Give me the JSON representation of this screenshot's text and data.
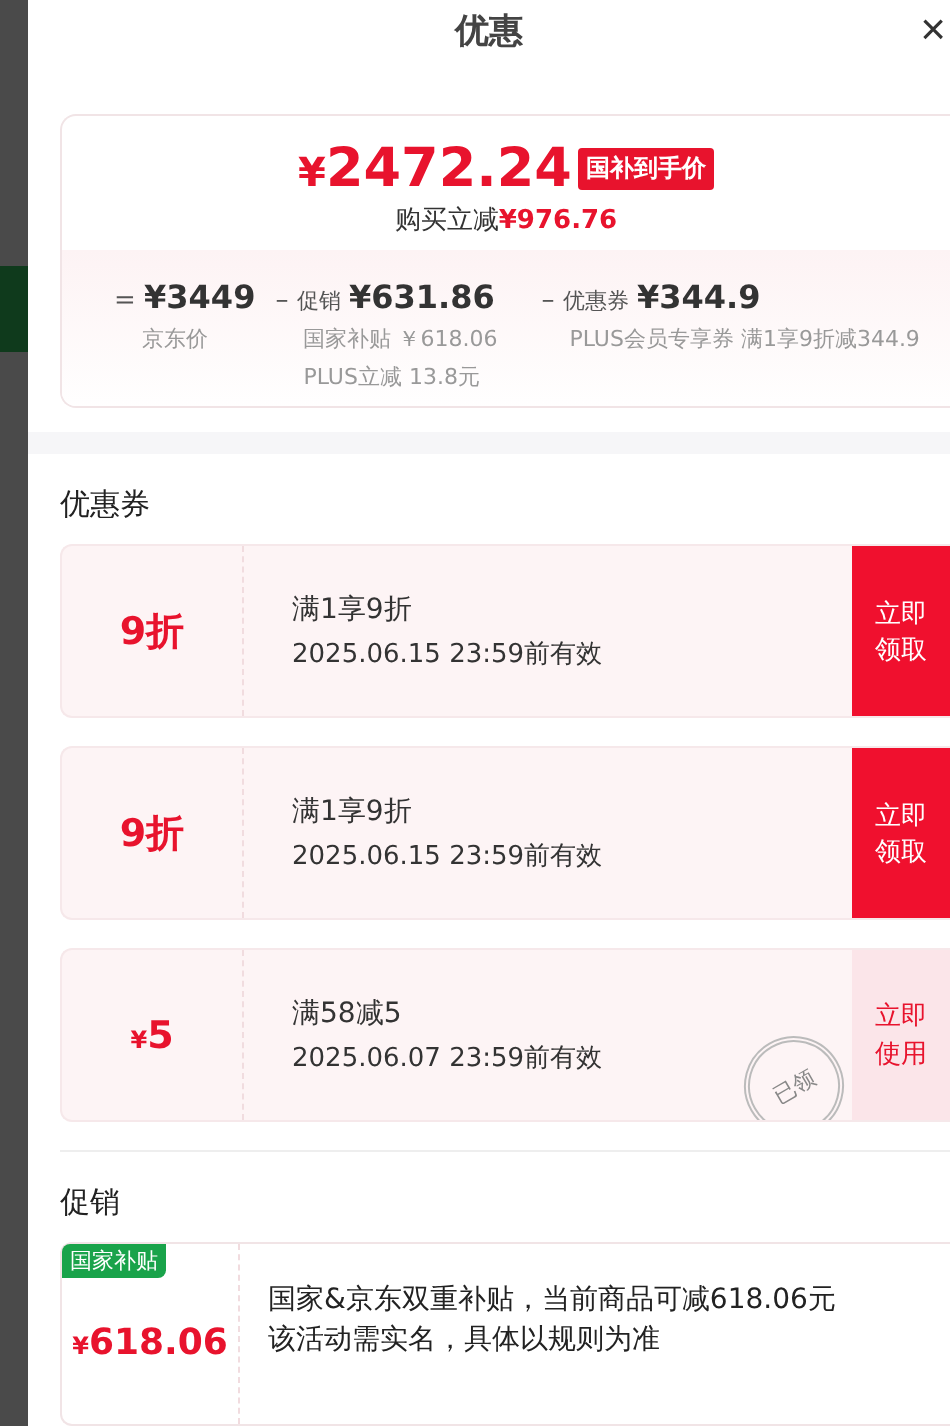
{
  "sheet": {
    "title": "优惠",
    "close": "×"
  },
  "price_card": {
    "currency": "¥",
    "price": "2472.24",
    "badge": "国补到手价",
    "saving_label": "购买立减",
    "saving": "¥976.76",
    "breakdown": [
      {
        "op": "=",
        "amount": "¥3449",
        "notes": [
          "京东价"
        ]
      },
      {
        "op": "–",
        "label": "促销",
        "amount": "¥631.86",
        "notes": [
          "国家补贴 ￥618.06",
          "PLUS立减 13.8元"
        ]
      },
      {
        "op": "–",
        "label": "优惠券",
        "amount": "¥344.9",
        "notes": [
          "PLUS会员专享券 满1享9折减344.9"
        ]
      }
    ]
  },
  "coupons_heading": "优惠券",
  "coupons": [
    {
      "kind": "discount",
      "value": "9折",
      "title": "满1享9折",
      "validity": "2025.06.15 23:59前有效",
      "action": "立即领取",
      "claimed": false
    },
    {
      "kind": "discount",
      "value": "9折",
      "title": "满1享9折",
      "validity": "2025.06.15 23:59前有效",
      "action": "立即领取",
      "claimed": false
    },
    {
      "kind": "cash",
      "currency": "¥",
      "value": "5",
      "title": "满58减5",
      "validity": "2025.06.07 23:59前有效",
      "action": "立即使用",
      "claimed": true,
      "stamp": "已领"
    }
  ],
  "promo_heading": "促销",
  "promos": [
    {
      "tag": "国家补贴",
      "currency": "¥",
      "value": "618.06",
      "lines": [
        "国家&京东双重补贴，当前商品可减618.06元",
        "该活动需实名，具体以规则为准"
      ]
    }
  ]
}
